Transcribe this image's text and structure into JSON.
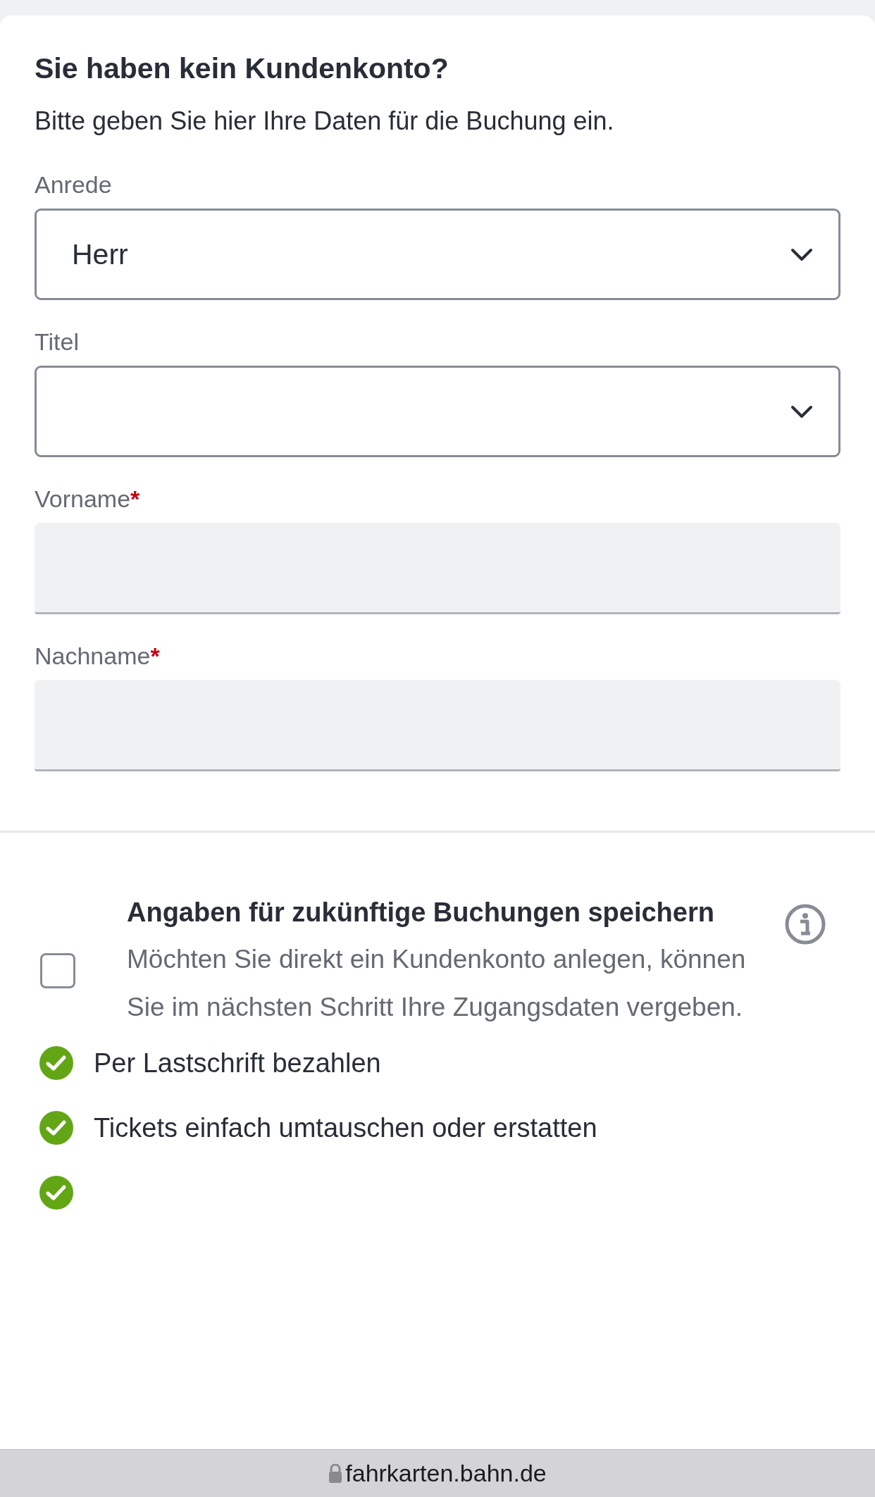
{
  "form": {
    "title": "Sie haben kein Kundenkonto?",
    "intro": "Bitte geben Sie hier Ihre Daten für die Buchung ein.",
    "fields": [
      {
        "kind": "select",
        "label": "Anrede",
        "value": "Herr"
      },
      {
        "kind": "select",
        "label": "Titel"
      },
      {
        "kind": "text",
        "label": "Vorname",
        "required_mark": "*"
      },
      {
        "kind": "text",
        "label": "Nachname",
        "required_mark": "*"
      }
    ]
  },
  "save_option": {
    "checked": false,
    "title": "Angaben für zukünftige Buchungen speichern",
    "description": "Möchten Sie direkt ein Kundenkonto anlegen, können Sie im nächsten Schritt Ihre Zugangsdaten vergeben."
  },
  "benefits": [
    "Per Lastschrift bezahlen",
    "Tickets einfach umtauschen oder erstatten"
  ],
  "address_bar": {
    "url": "fahrkarten.bahn.de"
  }
}
